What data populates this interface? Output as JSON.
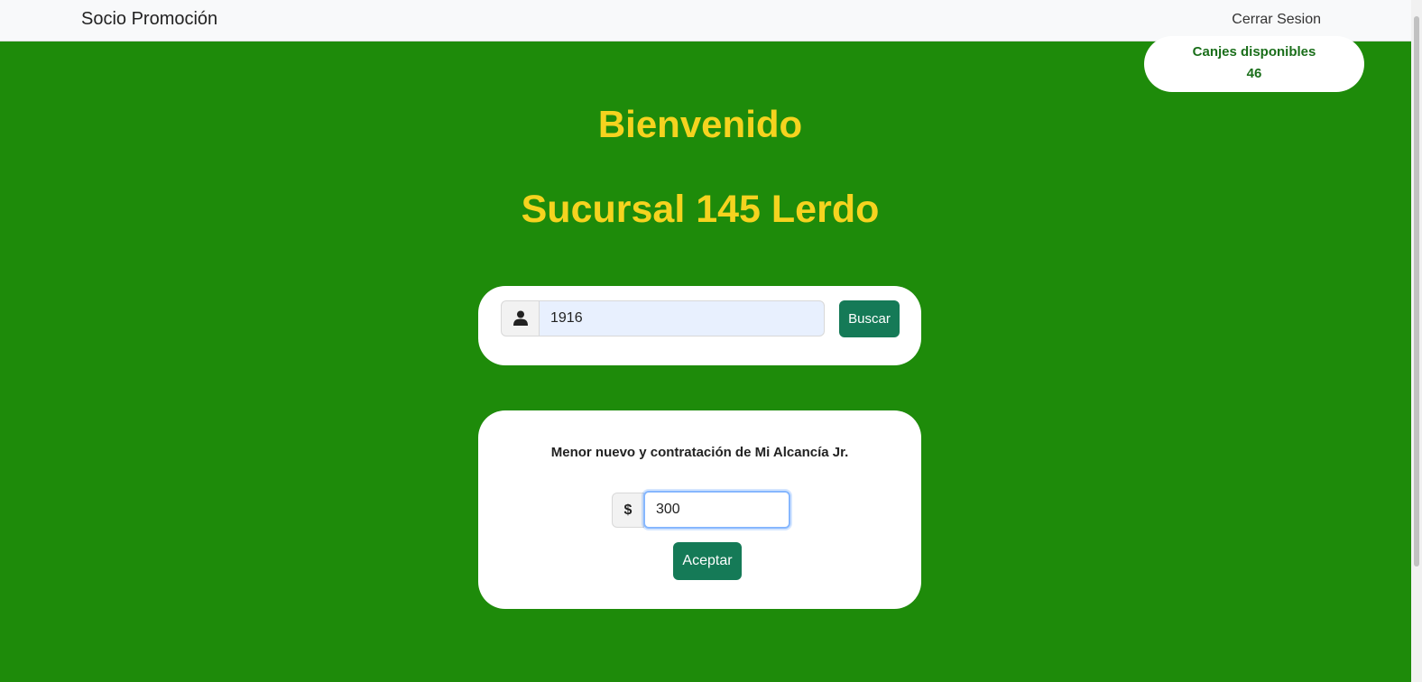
{
  "navbar": {
    "brand": "Socio Promoción",
    "logout": "Cerrar Sesion"
  },
  "canjes": {
    "label": "Canjes disponibles",
    "value": "46"
  },
  "headings": {
    "welcome": "Bienvenido",
    "branch": "Sucursal 145 Lerdo"
  },
  "search": {
    "icon": "user-icon",
    "value": "1916",
    "button": "Buscar"
  },
  "form": {
    "title": "Menor nuevo y contratación de Mi Alcancía Jr.",
    "currency": "$",
    "amount": "300",
    "button": "Aceptar"
  },
  "colors": {
    "background": "#1e8b0a",
    "heading": "#f5d31f",
    "button": "#157a57",
    "canjes_text": "#1a6e1a"
  }
}
